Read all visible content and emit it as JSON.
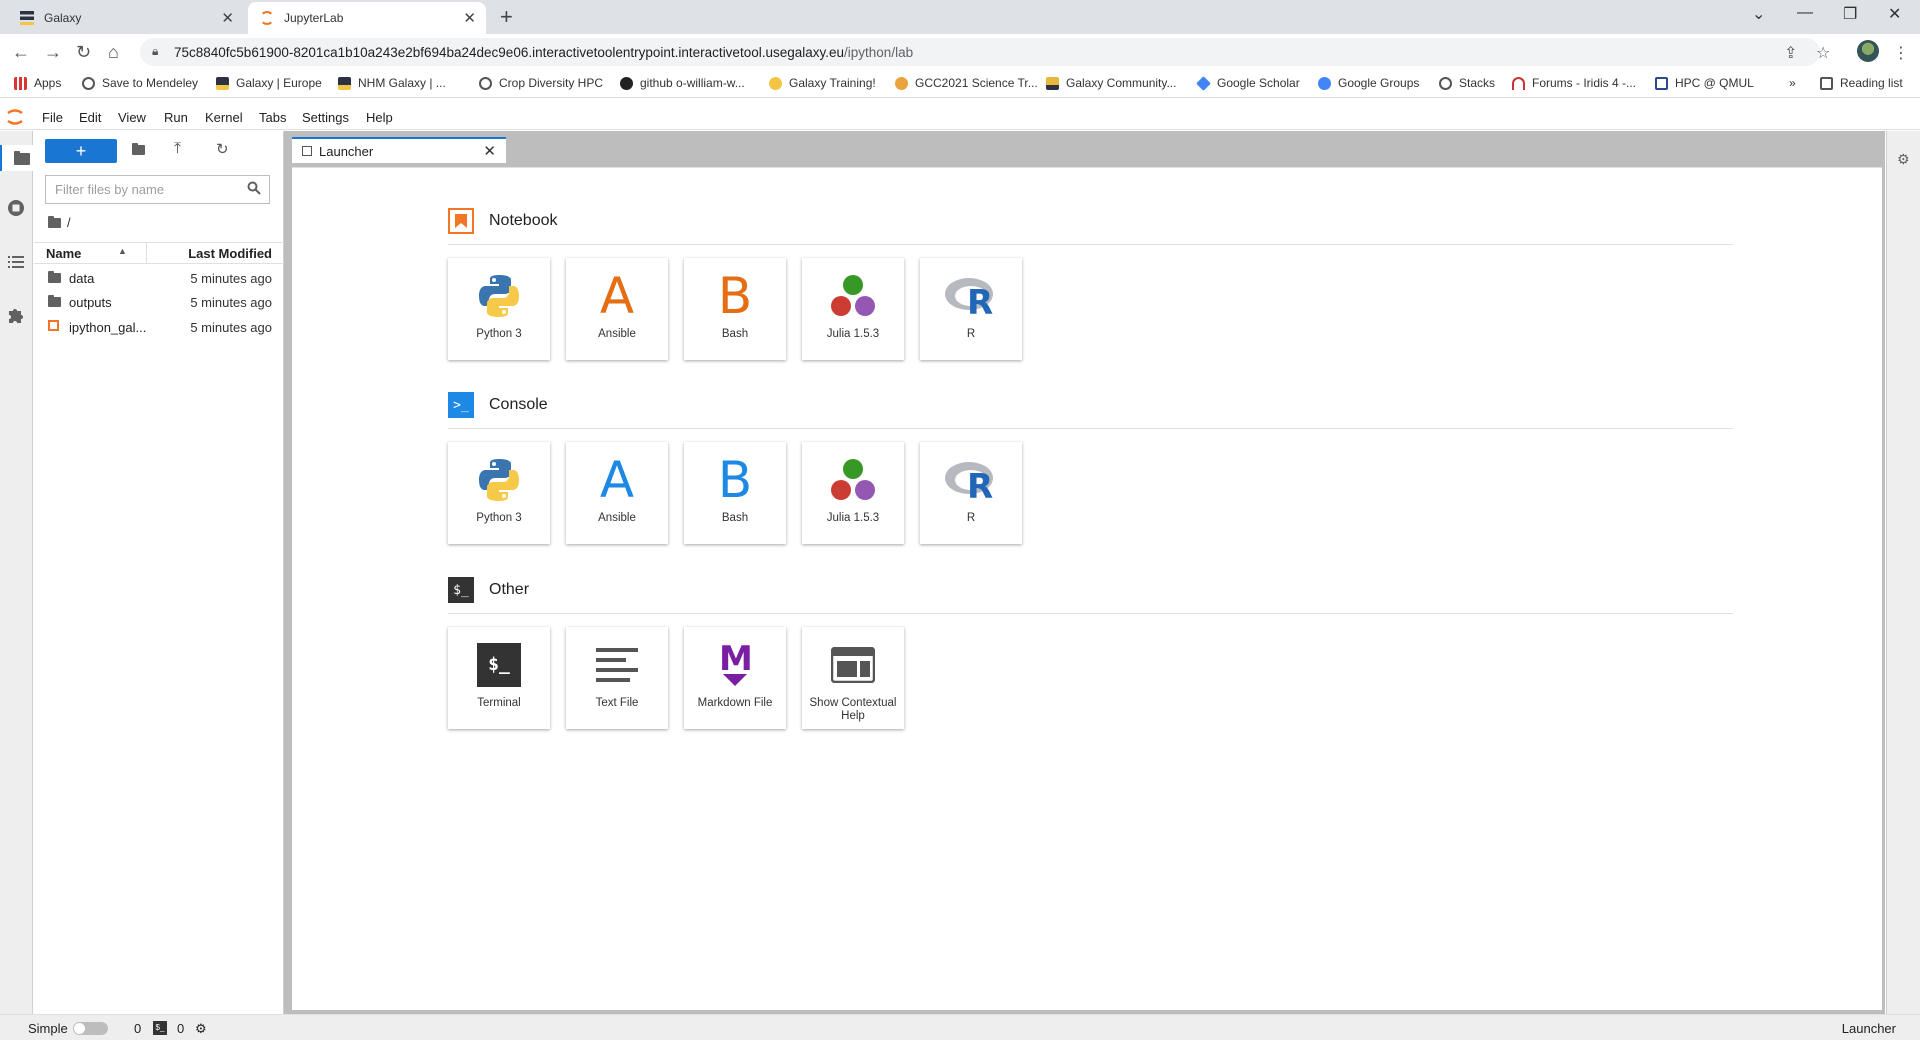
{
  "browser": {
    "tabs": [
      {
        "title": "Galaxy",
        "active": false
      },
      {
        "title": "JupyterLab",
        "active": true
      }
    ],
    "url_host": "75c8840fc5b61900-8201ca1b10a243e2bf694ba24dec9e06.interactivetoolentrypoint.interactivetool.usegalaxy.eu",
    "url_path": "/ipython/lab",
    "bookmarks": [
      "Apps",
      "Save to Mendeley",
      "Galaxy | Europe",
      "NHM Galaxy | ...",
      "Crop Diversity HPC",
      "github o-william-w...",
      "Galaxy Training!",
      "GCC2021 Science Tr...",
      "Galaxy Community...",
      "Google Scholar",
      "Google Groups",
      "Stacks",
      "Forums - Iridis 4 -...",
      "HPC @ QMUL"
    ],
    "bookmarks_overflow": "»",
    "reading_list": "Reading list"
  },
  "menu": [
    "File",
    "Edit",
    "View",
    "Run",
    "Kernel",
    "Tabs",
    "Settings",
    "Help"
  ],
  "filebrowser": {
    "new_label": "+",
    "filter_placeholder": "Filter files by name",
    "breadcrumb": "/",
    "col_name": "Name",
    "col_modified": "Last Modified",
    "items": [
      {
        "name": "data",
        "modified": "5 minutes ago",
        "kind": "folder"
      },
      {
        "name": "outputs",
        "modified": "5 minutes ago",
        "kind": "folder"
      },
      {
        "name": "ipython_gal...",
        "modified": "5 minutes ago",
        "kind": "notebook"
      }
    ]
  },
  "launcher": {
    "tab_title": "Launcher",
    "sections": {
      "notebook": {
        "title": "Notebook",
        "items": [
          "Python 3",
          "Ansible",
          "Bash",
          "Julia 1.5.3",
          "R"
        ]
      },
      "console": {
        "title": "Console",
        "items": [
          "Python 3",
          "Ansible",
          "Bash",
          "Julia 1.5.3",
          "R"
        ]
      },
      "other": {
        "title": "Other",
        "items": [
          "Terminal",
          "Text File",
          "Markdown File",
          "Show Contextual Help"
        ]
      }
    }
  },
  "status": {
    "simple_label": "Simple",
    "kernels_count": "0",
    "terminals_count": "0",
    "right_label": "Launcher"
  },
  "colors": {
    "accent": "#1976d2",
    "jupyter_orange": "#f37626",
    "ansible_notebook": "#e56d13",
    "ansible_console": "#1e88e5",
    "markdown_purple": "#7b1fa2"
  }
}
